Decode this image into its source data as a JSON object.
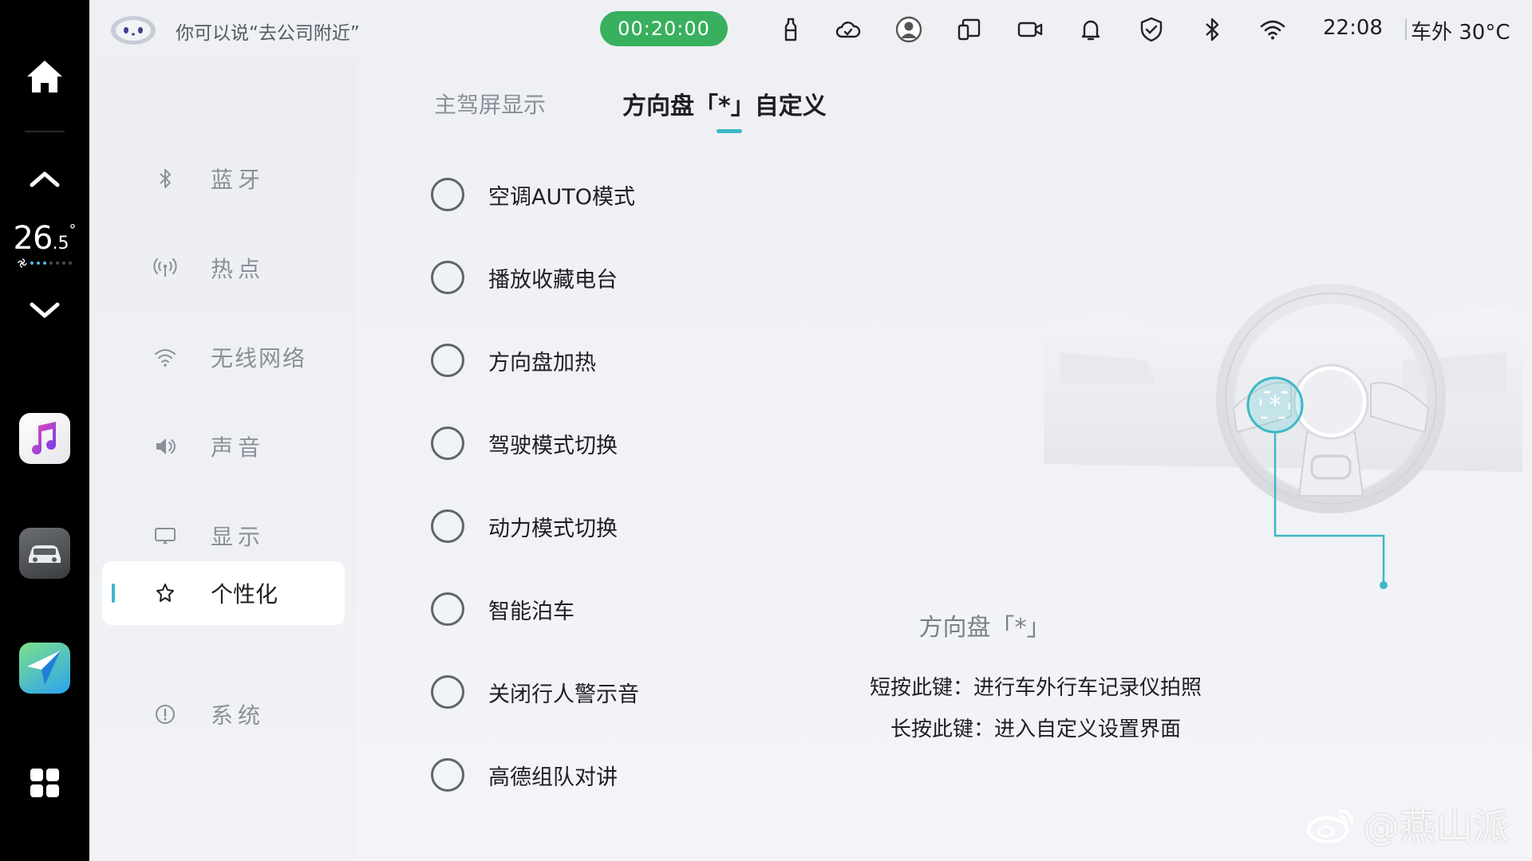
{
  "dock": {
    "temperature_int": "26",
    "temperature_dec": ".5",
    "temperature_deg": "°",
    "icons": [
      "home-icon",
      "chevron-up-icon",
      "chevron-down-icon",
      "music-app-icon",
      "car-app-icon",
      "navigation-app-icon",
      "apps-grid-icon"
    ]
  },
  "statusbar": {
    "voice_hint": "你可以说“去公司附近”",
    "timer": "00:20:00",
    "clock": "22:08",
    "outside_temp": "车外 30°C",
    "icons": [
      "bottle-icon",
      "cloud-icon",
      "user-icon",
      "devices-icon",
      "camera-icon",
      "bell-icon",
      "shield-icon",
      "bluetooth-icon",
      "wifi-icon"
    ],
    "timer_color": "#38b05e"
  },
  "sidebar": {
    "items": [
      {
        "label": "蓝牙",
        "icon": "bluetooth-icon"
      },
      {
        "label": "热点",
        "icon": "hotspot-icon"
      },
      {
        "label": "无线网络",
        "icon": "wifi-icon"
      },
      {
        "label": "声音",
        "icon": "speaker-icon"
      },
      {
        "label": "显示",
        "icon": "display-icon"
      },
      {
        "label": "个性化",
        "icon": "personalize-icon",
        "active": true
      },
      {
        "label": "系统",
        "icon": "system-icon"
      }
    ],
    "accent": "#3fb7c4"
  },
  "main": {
    "tabs": [
      {
        "label": "主驾屏显示"
      },
      {
        "label": "方向盘「*」自定义",
        "active": true
      }
    ],
    "options": [
      {
        "label": "空调AUTO模式",
        "selected": false
      },
      {
        "label": "播放收藏电台",
        "selected": false
      },
      {
        "label": "方向盘加热",
        "selected": false
      },
      {
        "label": "驾驶模式切换",
        "selected": false
      },
      {
        "label": "动力模式切换",
        "selected": false
      },
      {
        "label": "智能泊车",
        "selected": false
      },
      {
        "label": "关闭行人警示音",
        "selected": false
      },
      {
        "label": "高德组队对讲",
        "selected": false
      }
    ],
    "illustration": {
      "caption": "方向盘「*」",
      "line1": "短按此键：进行车外行车记录仪拍照",
      "line2": "长按此键：进入自定义设置界面"
    }
  },
  "watermark": {
    "text": "@燕山派"
  }
}
